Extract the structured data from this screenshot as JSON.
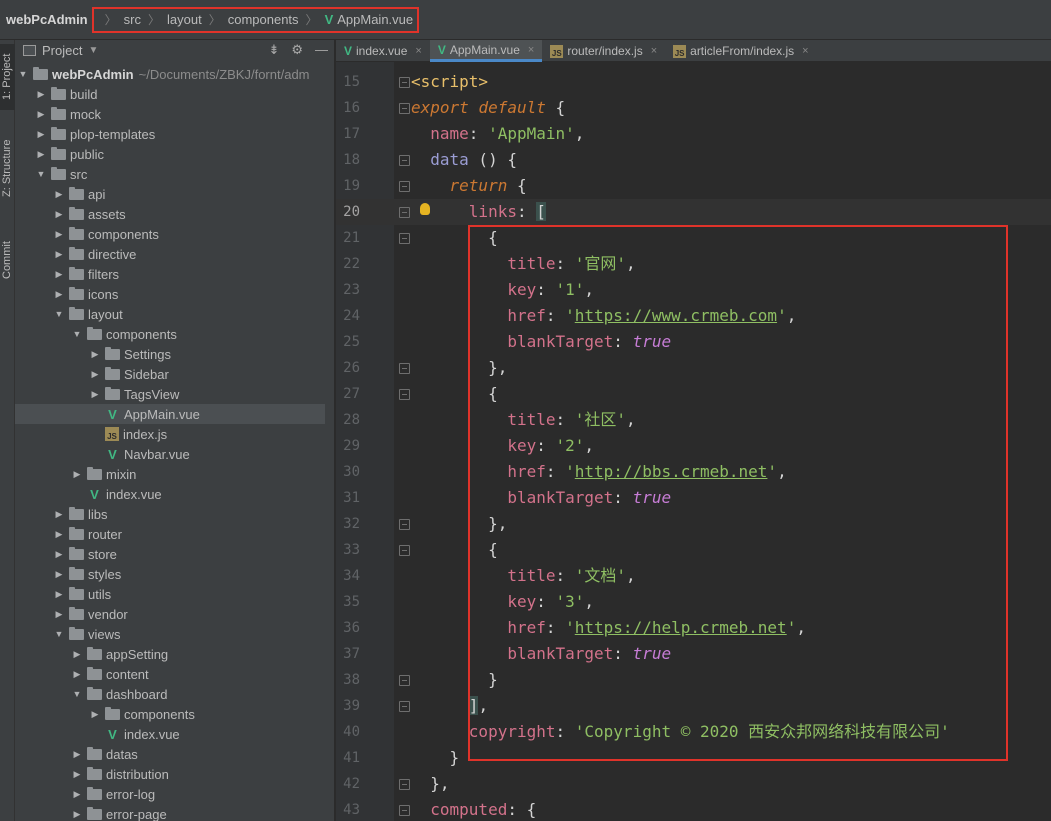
{
  "breadcrumb": {
    "project": "webPcAdmin",
    "items": [
      "src",
      "layout",
      "components"
    ],
    "file": "AppMain.vue"
  },
  "toolstrip": {
    "tabs": [
      "1: Project",
      "Z: Structure",
      "Commit"
    ]
  },
  "project_panel": {
    "title": "Project",
    "root": {
      "label": "webPcAdmin",
      "path": "~/Documents/ZBKJ/fornt/adm"
    },
    "rows": [
      {
        "label": "build",
        "depth": 1,
        "type": "folder",
        "expanded": false
      },
      {
        "label": "mock",
        "depth": 1,
        "type": "folder",
        "expanded": false
      },
      {
        "label": "plop-templates",
        "depth": 1,
        "type": "folder",
        "expanded": false
      },
      {
        "label": "public",
        "depth": 1,
        "type": "folder",
        "expanded": false
      },
      {
        "label": "src",
        "depth": 1,
        "type": "folder",
        "expanded": true
      },
      {
        "label": "api",
        "depth": 2,
        "type": "folder",
        "expanded": false
      },
      {
        "label": "assets",
        "depth": 2,
        "type": "folder",
        "expanded": false
      },
      {
        "label": "components",
        "depth": 2,
        "type": "folder",
        "expanded": false
      },
      {
        "label": "directive",
        "depth": 2,
        "type": "folder",
        "expanded": false
      },
      {
        "label": "filters",
        "depth": 2,
        "type": "folder",
        "expanded": false
      },
      {
        "label": "icons",
        "depth": 2,
        "type": "folder",
        "expanded": false
      },
      {
        "label": "layout",
        "depth": 2,
        "type": "folder",
        "expanded": true
      },
      {
        "label": "components",
        "depth": 3,
        "type": "folder",
        "expanded": true
      },
      {
        "label": "Settings",
        "depth": 4,
        "type": "folder",
        "expanded": false
      },
      {
        "label": "Sidebar",
        "depth": 4,
        "type": "folder",
        "expanded": false
      },
      {
        "label": "TagsView",
        "depth": 4,
        "type": "folder",
        "expanded": false
      },
      {
        "label": "AppMain.vue",
        "depth": 4,
        "type": "vue",
        "selected": true
      },
      {
        "label": "index.js",
        "depth": 4,
        "type": "js"
      },
      {
        "label": "Navbar.vue",
        "depth": 4,
        "type": "vue"
      },
      {
        "label": "mixin",
        "depth": 3,
        "type": "folder",
        "expanded": false
      },
      {
        "label": "index.vue",
        "depth": 3,
        "type": "vue"
      },
      {
        "label": "libs",
        "depth": 2,
        "type": "folder",
        "expanded": false
      },
      {
        "label": "router",
        "depth": 2,
        "type": "folder",
        "expanded": false
      },
      {
        "label": "store",
        "depth": 2,
        "type": "folder",
        "expanded": false
      },
      {
        "label": "styles",
        "depth": 2,
        "type": "folder",
        "expanded": false
      },
      {
        "label": "utils",
        "depth": 2,
        "type": "folder",
        "expanded": false
      },
      {
        "label": "vendor",
        "depth": 2,
        "type": "folder",
        "expanded": false
      },
      {
        "label": "views",
        "depth": 2,
        "type": "folder",
        "expanded": true
      },
      {
        "label": "appSetting",
        "depth": 3,
        "type": "folder",
        "expanded": false
      },
      {
        "label": "content",
        "depth": 3,
        "type": "folder",
        "expanded": false
      },
      {
        "label": "dashboard",
        "depth": 3,
        "type": "folder",
        "expanded": true
      },
      {
        "label": "components",
        "depth": 4,
        "type": "folder",
        "expanded": false
      },
      {
        "label": "index.vue",
        "depth": 4,
        "type": "vue"
      },
      {
        "label": "datas",
        "depth": 3,
        "type": "folder",
        "expanded": false
      },
      {
        "label": "distribution",
        "depth": 3,
        "type": "folder",
        "expanded": false
      },
      {
        "label": "error-log",
        "depth": 3,
        "type": "folder",
        "expanded": false
      },
      {
        "label": "error-page",
        "depth": 3,
        "type": "folder",
        "expanded": false
      }
    ]
  },
  "editor_tabs": [
    {
      "label": "index.vue",
      "type": "vue",
      "active": false
    },
    {
      "label": "AppMain.vue",
      "type": "vue",
      "active": true
    },
    {
      "label": "router/index.js",
      "type": "js",
      "active": false
    },
    {
      "label": "articleFrom/index.js",
      "type": "js",
      "active": false
    }
  ],
  "colors": {
    "highlight_box": "#e0332a",
    "vue_icon": "#41b883",
    "keyword": "#cc7832",
    "string": "#8fbf63",
    "property": "#d3728b",
    "boolean": "#c77dd6"
  },
  "code": {
    "current_line": 20,
    "lines": [
      {
        "n": "15",
        "tokens": [
          [
            "tag",
            "<script>"
          ]
        ]
      },
      {
        "n": "16",
        "tokens": [
          [
            "it",
            "export "
          ],
          [
            "it",
            "default "
          ],
          [
            "pun",
            "{"
          ]
        ]
      },
      {
        "n": "17",
        "tokens": [
          [
            "pun",
            "  "
          ],
          [
            "prop",
            "name"
          ],
          [
            "pun",
            ": "
          ],
          [
            "str",
            "'AppMain'"
          ],
          [
            "pun",
            ","
          ]
        ]
      },
      {
        "n": "18",
        "tokens": [
          [
            "pun",
            "  "
          ],
          [
            "fn",
            "data"
          ],
          [
            "pun",
            " () {"
          ]
        ]
      },
      {
        "n": "19",
        "tokens": [
          [
            "pun",
            "    "
          ],
          [
            "it",
            "return "
          ],
          [
            "pun",
            "{"
          ]
        ]
      },
      {
        "n": "20",
        "tokens": [
          [
            "pun",
            "      "
          ],
          [
            "prop",
            "links"
          ],
          [
            "pun",
            ": "
          ],
          [
            "bracket",
            "["
          ]
        ]
      },
      {
        "n": "21",
        "tokens": [
          [
            "pun",
            "        {"
          ]
        ]
      },
      {
        "n": "22",
        "tokens": [
          [
            "pun",
            "          "
          ],
          [
            "prop",
            "title"
          ],
          [
            "pun",
            ": "
          ],
          [
            "str",
            "'官网'"
          ],
          [
            "pun",
            ","
          ]
        ]
      },
      {
        "n": "23",
        "tokens": [
          [
            "pun",
            "          "
          ],
          [
            "prop",
            "key"
          ],
          [
            "pun",
            ": "
          ],
          [
            "str",
            "'1'"
          ],
          [
            "pun",
            ","
          ]
        ]
      },
      {
        "n": "24",
        "tokens": [
          [
            "pun",
            "          "
          ],
          [
            "prop",
            "href"
          ],
          [
            "pun",
            ": "
          ],
          [
            "str",
            "'"
          ],
          [
            "url",
            "https://www.crmeb.com"
          ],
          [
            "str",
            "'"
          ],
          [
            "pun",
            ","
          ]
        ]
      },
      {
        "n": "25",
        "tokens": [
          [
            "pun",
            "          "
          ],
          [
            "prop",
            "blankTarget"
          ],
          [
            "pun",
            ": "
          ],
          [
            "bool",
            "true"
          ]
        ]
      },
      {
        "n": "26",
        "tokens": [
          [
            "pun",
            "        },"
          ]
        ]
      },
      {
        "n": "27",
        "tokens": [
          [
            "pun",
            "        {"
          ]
        ]
      },
      {
        "n": "28",
        "tokens": [
          [
            "pun",
            "          "
          ],
          [
            "prop",
            "title"
          ],
          [
            "pun",
            ": "
          ],
          [
            "str",
            "'社区'"
          ],
          [
            "pun",
            ","
          ]
        ]
      },
      {
        "n": "29",
        "tokens": [
          [
            "pun",
            "          "
          ],
          [
            "prop",
            "key"
          ],
          [
            "pun",
            ": "
          ],
          [
            "str",
            "'2'"
          ],
          [
            "pun",
            ","
          ]
        ]
      },
      {
        "n": "30",
        "tokens": [
          [
            "pun",
            "          "
          ],
          [
            "prop",
            "href"
          ],
          [
            "pun",
            ": "
          ],
          [
            "str",
            "'"
          ],
          [
            "url",
            "http://bbs.crmeb.net"
          ],
          [
            "str",
            "'"
          ],
          [
            "pun",
            ","
          ]
        ]
      },
      {
        "n": "31",
        "tokens": [
          [
            "pun",
            "          "
          ],
          [
            "prop",
            "blankTarget"
          ],
          [
            "pun",
            ": "
          ],
          [
            "bool",
            "true"
          ]
        ]
      },
      {
        "n": "32",
        "tokens": [
          [
            "pun",
            "        },"
          ]
        ]
      },
      {
        "n": "33",
        "tokens": [
          [
            "pun",
            "        {"
          ]
        ]
      },
      {
        "n": "34",
        "tokens": [
          [
            "pun",
            "          "
          ],
          [
            "prop",
            "title"
          ],
          [
            "pun",
            ": "
          ],
          [
            "str",
            "'文档'"
          ],
          [
            "pun",
            ","
          ]
        ]
      },
      {
        "n": "35",
        "tokens": [
          [
            "pun",
            "          "
          ],
          [
            "prop",
            "key"
          ],
          [
            "pun",
            ": "
          ],
          [
            "str",
            "'3'"
          ],
          [
            "pun",
            ","
          ]
        ]
      },
      {
        "n": "36",
        "tokens": [
          [
            "pun",
            "          "
          ],
          [
            "prop",
            "href"
          ],
          [
            "pun",
            ": "
          ],
          [
            "str",
            "'"
          ],
          [
            "url",
            "https://help.crmeb.net"
          ],
          [
            "str",
            "'"
          ],
          [
            "pun",
            ","
          ]
        ]
      },
      {
        "n": "37",
        "tokens": [
          [
            "pun",
            "          "
          ],
          [
            "prop",
            "blankTarget"
          ],
          [
            "pun",
            ": "
          ],
          [
            "bool",
            "true"
          ]
        ]
      },
      {
        "n": "38",
        "tokens": [
          [
            "pun",
            "        }"
          ]
        ]
      },
      {
        "n": "39",
        "tokens": [
          [
            "pun",
            "      "
          ],
          [
            "bracket",
            "]"
          ],
          [
            "pun",
            ","
          ]
        ]
      },
      {
        "n": "40",
        "tokens": [
          [
            "pun",
            "      "
          ],
          [
            "prop",
            "copyright"
          ],
          [
            "pun",
            ": "
          ],
          [
            "str",
            "'Copyright © 2020 西安众邦网络科技有限公司'"
          ]
        ]
      },
      {
        "n": "41",
        "tokens": [
          [
            "pun",
            "    }"
          ]
        ]
      },
      {
        "n": "42",
        "tokens": [
          [
            "pun",
            "  },"
          ]
        ]
      },
      {
        "n": "43",
        "tokens": [
          [
            "pun",
            "  "
          ],
          [
            "prop",
            "computed"
          ],
          [
            "pun",
            ": {"
          ]
        ]
      }
    ]
  }
}
